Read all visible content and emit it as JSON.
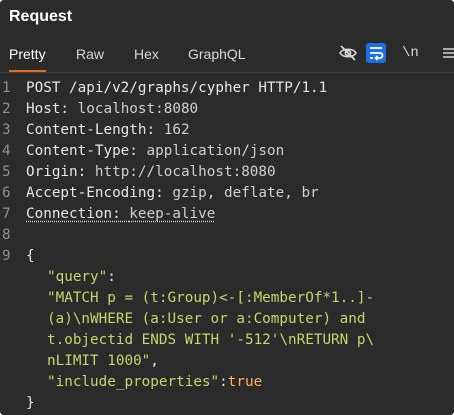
{
  "header": {
    "title": "Request"
  },
  "tabs": [
    {
      "label": "Pretty",
      "active": true
    },
    {
      "label": "Raw",
      "active": false
    },
    {
      "label": "Hex",
      "active": false
    },
    {
      "label": "GraphQL",
      "active": false
    }
  ],
  "toolbar": {
    "hide_icon": "eye-off-icon",
    "wrap_icon": "word-wrap-icon",
    "newline_label": "\\n",
    "menu_icon": "hamburger-menu-icon"
  },
  "colors": {
    "accent": "#e06d1b",
    "wrap_button_bg": "#1f6feb",
    "string": "#c1d96a",
    "number": "#ffae57",
    "background": "#2b2b2b"
  },
  "editor": {
    "line_numbers": [
      "1",
      "2",
      "3",
      "4",
      "5",
      "6",
      "7",
      "8",
      "9"
    ],
    "request_line": "POST /api/v2/graphs/cypher HTTP/1.1",
    "headers": [
      {
        "name": "Host:",
        "value": "localhost:8080"
      },
      {
        "name": "Content-Length:",
        "value": "162"
      },
      {
        "name": "Content-Type:",
        "value": "application/json"
      },
      {
        "name": "Origin:",
        "value": "http://localhost:8080"
      },
      {
        "name": "Accept-Encoding:",
        "value": "gzip, deflate, br"
      },
      {
        "name": "Connection:",
        "value": "keep-alive"
      }
    ],
    "body": {
      "open_brace": "{",
      "query_key": "\"query\"",
      "query_colon": ":",
      "query_lines": [
        "\"MATCH p = (t:Group)<-[:MemberOf*1..]-",
        "(a)\\nWHERE (a:User or a:Computer) and",
        "t.objectid ENDS WITH '-512'\\nRETURN p\\",
        "nLIMIT 1000\""
      ],
      "query_trailing_comma": ",",
      "include_key": "\"include_properties\"",
      "include_colon": ":",
      "include_value": "true",
      "close_brace": "}"
    }
  }
}
